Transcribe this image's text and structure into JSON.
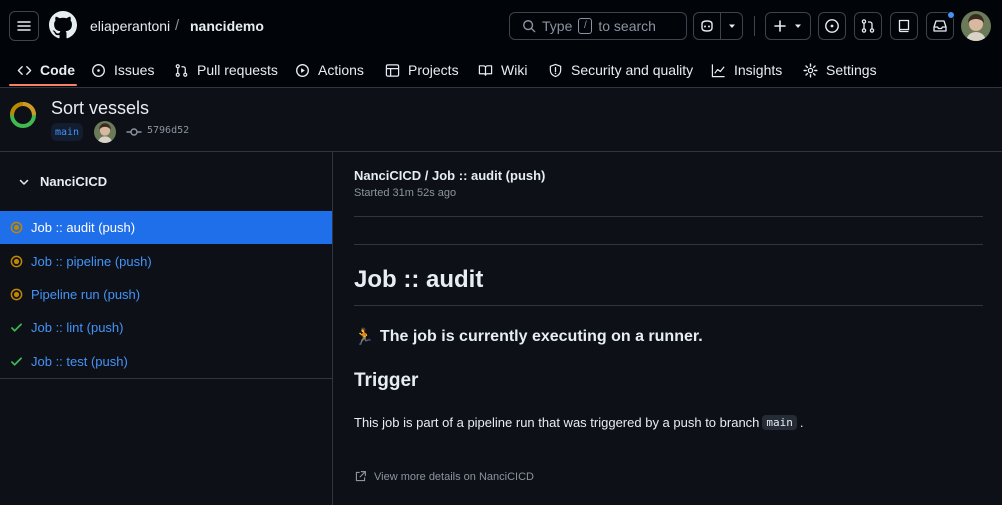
{
  "header": {
    "owner": "eliaperantoni",
    "separator": "/",
    "repo": "nancidemo",
    "search": {
      "prefix": "Type",
      "key": "/",
      "suffix": "to search"
    }
  },
  "repo_nav": {
    "tabs": [
      {
        "label": "Code",
        "icon": "code-icon",
        "active": true
      },
      {
        "label": "Issues",
        "icon": "issue-opened-icon"
      },
      {
        "label": "Pull requests",
        "icon": "git-pull-request-icon"
      },
      {
        "label": "Actions",
        "icon": "play-icon"
      },
      {
        "label": "Projects",
        "icon": "table-icon"
      },
      {
        "label": "Wiki",
        "icon": "book-icon"
      },
      {
        "label": "Security and quality",
        "icon": "shield-icon"
      },
      {
        "label": "Insights",
        "icon": "graph-icon"
      },
      {
        "label": "Settings",
        "icon": "gear-icon"
      }
    ]
  },
  "run": {
    "title": "Sort vessels",
    "branch": "main",
    "commit_sha": "5796d52",
    "status": "in_progress"
  },
  "sidebar": {
    "workflow_name": "NanciCICD",
    "jobs": [
      {
        "label": "Job :: audit (push)",
        "status": "in_progress",
        "active": true
      },
      {
        "label": "Job :: pipeline (push)",
        "status": "in_progress"
      },
      {
        "label": "Pipeline run (push)",
        "status": "in_progress"
      },
      {
        "label": "Job :: lint (push)",
        "status": "success"
      },
      {
        "label": "Job :: test (push)",
        "status": "success"
      }
    ]
  },
  "main": {
    "job_path": "NanciCICD / Job :: audit (push)",
    "started": "Started 31m 52s ago",
    "heading": "Job :: audit",
    "status_emoji": "🏃",
    "status_text": "The job is currently executing on a runner.",
    "trigger_heading": "Trigger",
    "trigger_text_before": "This job is part of a pipeline run that was triggered by a push to branch",
    "trigger_branch": "main",
    "trigger_text_after": ".",
    "more_details": "View more details on NanciCICD"
  },
  "colors": {
    "background": "#0d1117",
    "header_bg": "#010409",
    "border": "#30363d",
    "link": "#4493f8",
    "active_job_bg": "#1f6feb",
    "in_progress": "#bf8700",
    "success": "#3fb950",
    "tab_underline": "#f78166"
  }
}
